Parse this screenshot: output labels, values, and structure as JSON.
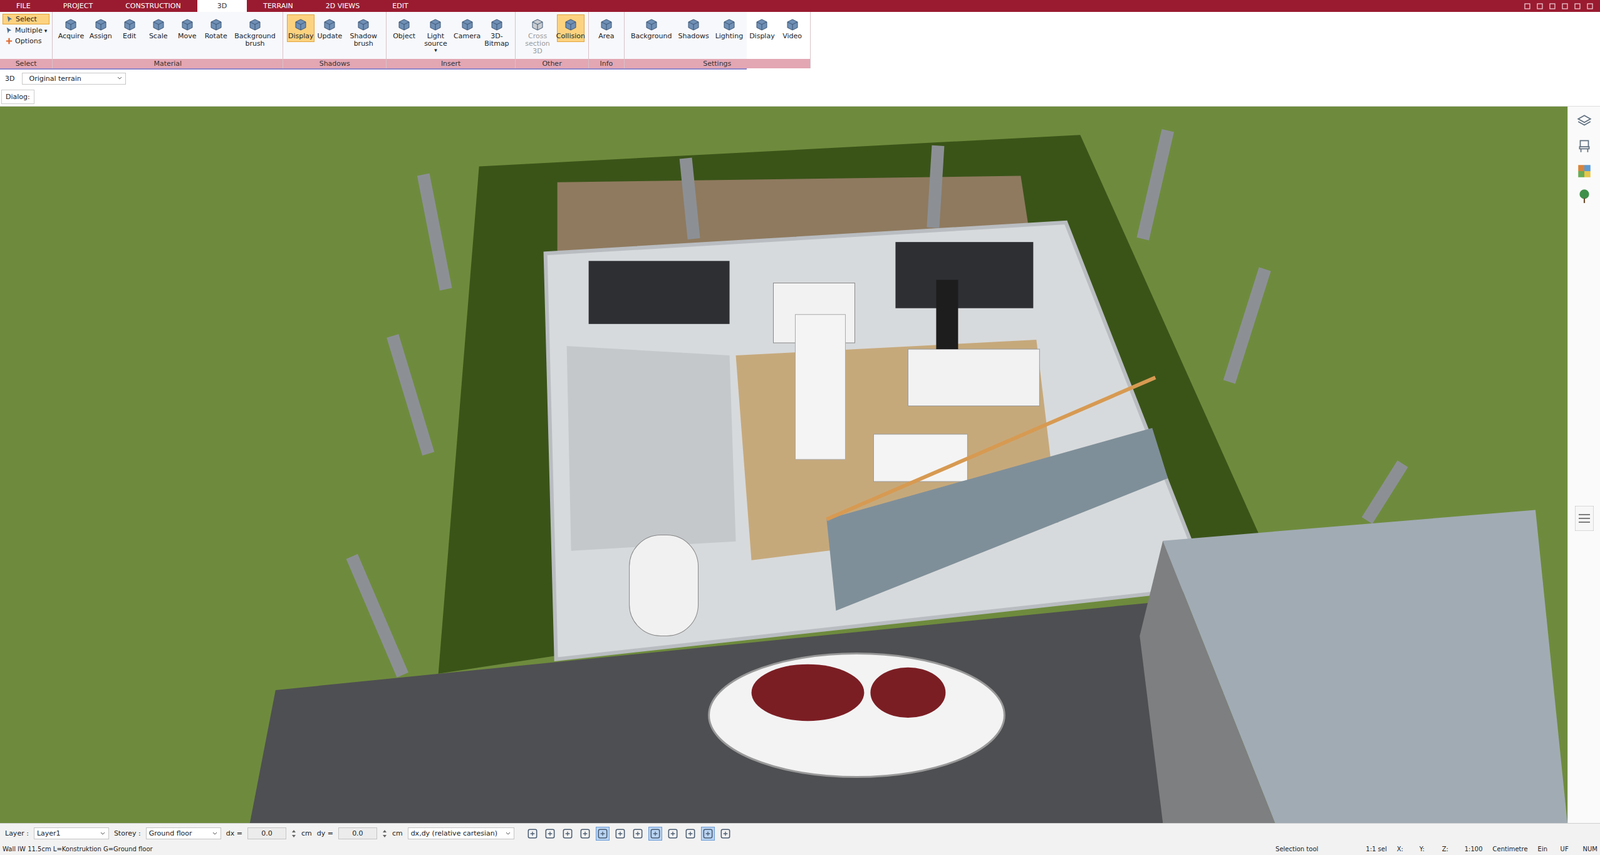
{
  "menu_tabs": [
    {
      "label": "FILE",
      "selected": false
    },
    {
      "label": "PROJECT",
      "selected": false
    },
    {
      "label": "CONSTRUCTION",
      "selected": false
    },
    {
      "label": "3D",
      "selected": true
    },
    {
      "label": "TERRAIN",
      "selected": false
    },
    {
      "label": "2D VIEWS",
      "selected": false
    },
    {
      "label": "EDIT",
      "selected": false
    }
  ],
  "ribbon": {
    "select_group": {
      "title": "Select",
      "items": [
        {
          "label": "Select",
          "selected": true,
          "caret": ""
        },
        {
          "label": "Multiple",
          "selected": false,
          "caret": "▾"
        },
        {
          "label": "Options",
          "selected": false,
          "caret": ""
        }
      ]
    },
    "groups": [
      {
        "title": "Material",
        "buttons": [
          {
            "label": "Acquire",
            "selected": false,
            "disabled": false,
            "caret": ""
          },
          {
            "label": "Assign",
            "selected": false,
            "disabled": false,
            "caret": ""
          },
          {
            "label": "Edit",
            "selected": false,
            "disabled": false,
            "caret": ""
          },
          {
            "label": "Scale",
            "selected": false,
            "disabled": false,
            "caret": ""
          },
          {
            "label": "Move",
            "selected": false,
            "disabled": false,
            "caret": ""
          },
          {
            "label": "Rotate",
            "selected": false,
            "disabled": false,
            "caret": ""
          },
          {
            "label": "Background brush",
            "selected": false,
            "disabled": false,
            "caret": ""
          }
        ]
      },
      {
        "title": "Shadows",
        "buttons": [
          {
            "label": "Display",
            "selected": true,
            "disabled": false,
            "caret": ""
          },
          {
            "label": "Update",
            "selected": false,
            "disabled": false,
            "caret": ""
          },
          {
            "label": "Shadow brush",
            "selected": false,
            "disabled": false,
            "caret": ""
          }
        ]
      },
      {
        "title": "Insert",
        "buttons": [
          {
            "label": "Object",
            "selected": false,
            "disabled": false,
            "caret": ""
          },
          {
            "label": "Light source",
            "selected": false,
            "disabled": false,
            "caret": "▾"
          },
          {
            "label": "Camera",
            "selected": false,
            "disabled": false,
            "caret": ""
          },
          {
            "label": "3D-Bitmap",
            "selected": false,
            "disabled": false,
            "caret": ""
          }
        ]
      },
      {
        "title": "Other",
        "buttons": [
          {
            "label": "Cross section 3D",
            "selected": false,
            "disabled": true,
            "caret": ""
          },
          {
            "label": "Collision",
            "selected": true,
            "disabled": false,
            "caret": ""
          }
        ]
      },
      {
        "title": "Info",
        "buttons": [
          {
            "label": "Area",
            "selected": false,
            "disabled": false,
            "caret": ""
          }
        ]
      },
      {
        "title": "Settings",
        "buttons": [
          {
            "label": "Background",
            "selected": false,
            "disabled": false,
            "caret": ""
          },
          {
            "label": "Shadows",
            "selected": false,
            "disabled": false,
            "caret": ""
          },
          {
            "label": "Lighting",
            "selected": false,
            "disabled": false,
            "caret": ""
          },
          {
            "label": "Display",
            "selected": false,
            "disabled": false,
            "caret": ""
          },
          {
            "label": "Video",
            "selected": false,
            "disabled": false,
            "caret": ""
          }
        ]
      }
    ]
  },
  "view_bar": {
    "mode": "3D",
    "terrain": "Original terrain"
  },
  "dialog_label": "Dialog:",
  "bottom_bar": {
    "layer_label": "Layer :",
    "layer": "Layer1",
    "storey_label": "Storey :",
    "storey": "Ground floor",
    "dx_label": "dx =",
    "dx": "0.0",
    "dx_unit": "cm",
    "dy_label": "dy =",
    "dy": "0.0",
    "dy_unit": "cm",
    "coord_mode": "dx,dy (relative cartesian)",
    "tools": [
      {
        "selected": false
      },
      {
        "selected": false
      },
      {
        "selected": false
      },
      {
        "selected": false
      },
      {
        "selected": true
      },
      {
        "selected": false
      },
      {
        "selected": false
      },
      {
        "selected": true
      },
      {
        "selected": false
      },
      {
        "selected": false
      },
      {
        "selected": true
      },
      {
        "selected": false
      }
    ]
  },
  "status_bar": {
    "message": "Wall IW 11.5cm L=Konstruktion G=Ground floor",
    "tool": "Selection tool",
    "fields": [
      "1:1 sel",
      "X:",
      "Y:",
      "Z:",
      "1:100",
      "Centimetre",
      "Ein",
      "UF",
      "NUM"
    ]
  }
}
